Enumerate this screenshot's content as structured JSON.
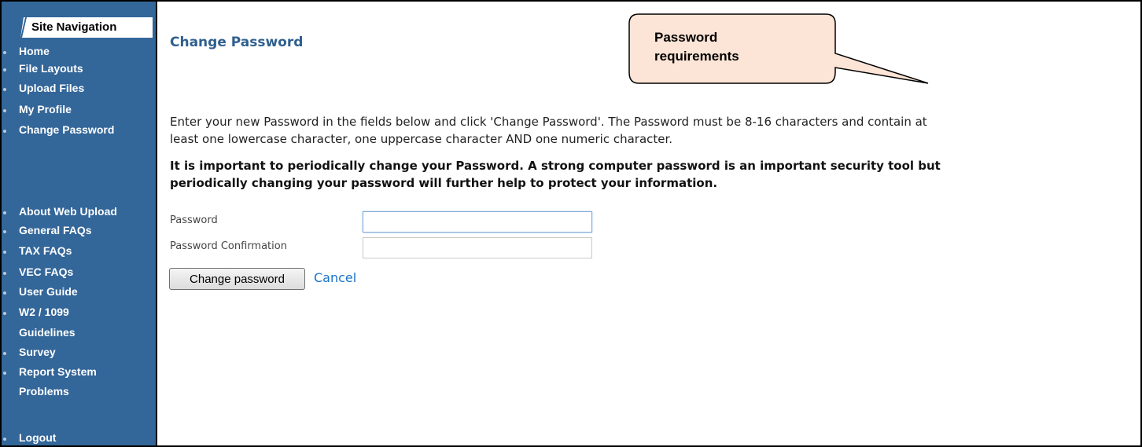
{
  "sidebar": {
    "header": "Site Navigation",
    "items": [
      {
        "label": "Home"
      },
      {
        "label": "File Layouts"
      },
      {
        "label": "Upload Files"
      },
      {
        "label": "My Profile"
      },
      {
        "label": "Change Password"
      },
      {
        "label": "About Web Upload"
      },
      {
        "label": "General FAQs"
      },
      {
        "label": "TAX FAQs"
      },
      {
        "label": "VEC FAQs"
      },
      {
        "label": "User Guide"
      },
      {
        "label": "W2 / 1099"
      },
      {
        "label": "Guidelines"
      },
      {
        "label": "Survey"
      },
      {
        "label": "Report System"
      },
      {
        "label": "Problems"
      },
      {
        "label": "Logout"
      }
    ]
  },
  "main": {
    "title": "Change Password",
    "instructions_line1": "Enter your new Password in the fields below and click 'Change Password'. The Password must be 8-16 characters and contain at",
    "instructions_line2": "least one lowercase character, one uppercase character AND one numeric character.",
    "warning_line1": "It is important to periodically change your Password. A strong computer password is an important security tool but",
    "warning_line2": "periodically changing your password will further help to protect your information.",
    "password_label": "Password",
    "password_value": "",
    "confirm_label": "Password Confirmation",
    "confirm_value": "",
    "submit_label": "Change password",
    "cancel_label": "Cancel"
  },
  "callout": {
    "line1": "Password",
    "line2": "requirements",
    "fill_color": "#fce4d6"
  },
  "colors": {
    "sidebar_bg": "#336699",
    "title": "#2f5f8f",
    "link": "#1a73c9"
  }
}
